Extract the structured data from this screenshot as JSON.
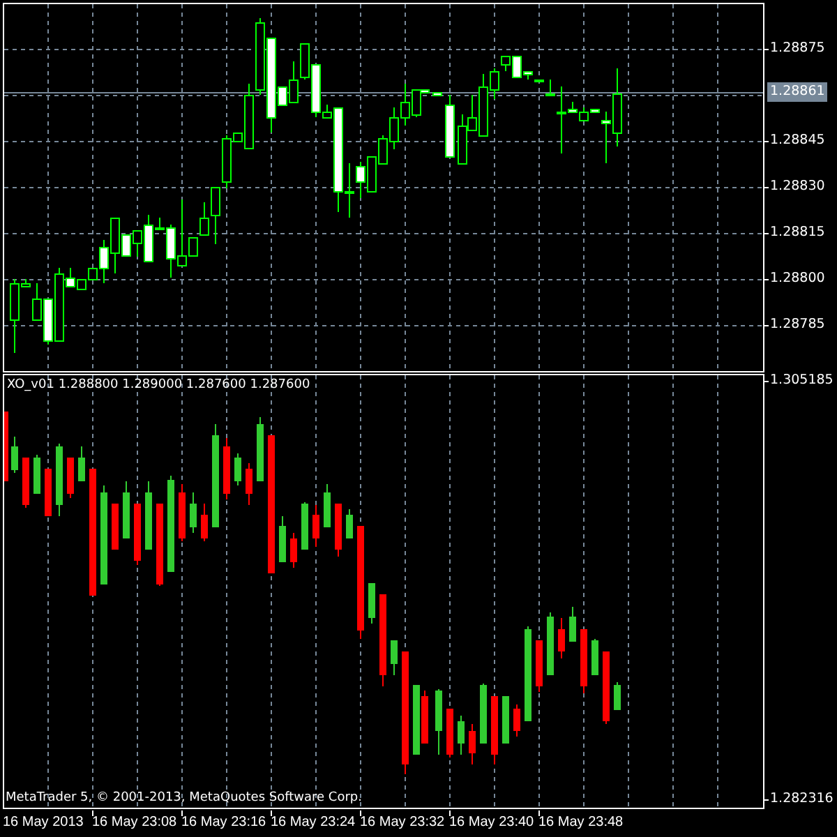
{
  "main_chart": {
    "axis_labels": [
      "1.28875",
      "1.28845",
      "1.28830",
      "1.28815",
      "1.28800",
      "1.28785"
    ],
    "current_price": "1.28861"
  },
  "indicator_window": {
    "legend": "XO_v01 1.288800 1.289000 1.287600 1.287600",
    "copyright": "MetaTrader 5, © 2001-2013, MetaQuotes Software Corp.",
    "axis_labels": [
      "1.305185",
      "1.282316"
    ]
  },
  "time_axis": {
    "labels": [
      "16 May 2013",
      "16 May 23:08",
      "16 May 23:16",
      "16 May 23:24",
      "16 May 23:32",
      "16 May 23:40",
      "16 May 23:48"
    ]
  }
}
